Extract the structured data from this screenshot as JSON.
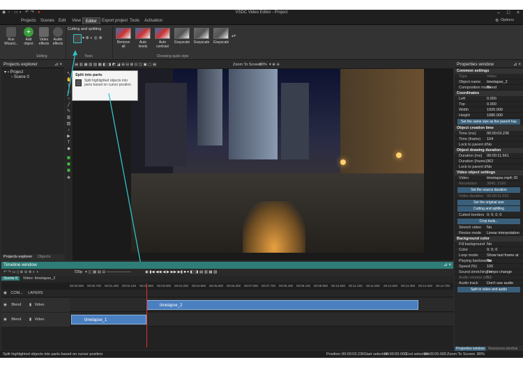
{
  "window": {
    "title": "VSDC Video Editor - Project"
  },
  "menu": [
    {
      "label": "Projects"
    },
    {
      "label": "Scenes"
    },
    {
      "label": "Edit"
    },
    {
      "label": "View"
    },
    {
      "label": "Editor"
    },
    {
      "label": "Export project"
    },
    {
      "label": "Tools"
    },
    {
      "label": "Activation"
    }
  ],
  "options_label": "Options",
  "ribbon": {
    "run_wizard": "Run Wizard...",
    "add_object": "Add object",
    "video_effects": "Video effects",
    "audio_effects": "Audio effects",
    "editing_group": "Editing",
    "cutting_label": "Cutting and splitting",
    "tools_group": "Tools",
    "quick_style_group": "Choosing quick style",
    "quick_styles": [
      "Remove all",
      "Auto levels",
      "Auto contrast",
      "Grayscale",
      "Grayscale",
      "Grayscale"
    ]
  },
  "tooltip": {
    "title": "Split into parts",
    "body": "Split highlighted objects into parts based on cursor position"
  },
  "projects_explorer": {
    "title": "Projects explorer",
    "project": "Project",
    "scene": "Scene 0",
    "tab1": "Projects explorer",
    "tab2": "Objects explorer"
  },
  "preview_toolbar": {
    "zoom": "Zoom To Screen",
    "percent": "80%"
  },
  "properties": {
    "title": "Properties window",
    "common": "Common settings",
    "type_lbl": "Type",
    "type_val": "Video",
    "name_lbl": "Object name",
    "name_val": "timelapse_2",
    "comp_lbl": "Composition mode",
    "comp_val": "Blend",
    "coords": "Coordinates",
    "left_lbl": "Left",
    "left_val": "0.000",
    "top_lbl": "Top",
    "top_val": "0.000",
    "width_lbl": "Width",
    "width_val": "1920.000",
    "height_lbl": "Height",
    "height_val": "1080.000",
    "same_size_btn": "Set the same size as the parent has",
    "creation": "Object creation time",
    "time_ms_lbl": "Time (ms)",
    "time_ms_val": "00:00:03.236",
    "time_frame_lbl": "Time (frame)",
    "time_frame_val": "104",
    "lock_lbl": "Lock to parent d",
    "lock_val": "No",
    "drawing": "Object drawing duration",
    "dur_ms_lbl": "Duration (ms)",
    "dur_ms_val": "00:00:11.561",
    "dur_frame_lbl": "Duration (frame)",
    "dur_frame_val": "362",
    "lock2_lbl": "Lock to parent d",
    "lock2_val": "No",
    "video_settings": "Video object settings",
    "video_lbl": "Video",
    "video_val": "timelapse.mp4; ID",
    "resolution_lbl": "Resolution",
    "resolution_val": "3840; 2160",
    "source_btn": "Set the source duration",
    "video_dur_lbl": "Video duration",
    "video_dur_val": "00:00:11.561",
    "orig_size_btn": "Set the original size",
    "cutting_btn": "Cutting and splitting",
    "cutted_lbl": "Cutted borders",
    "cutted_val": "0; 0; 0; 0",
    "crop_btn": "Crop tools...",
    "stretch_lbl": "Stretch video",
    "stretch_val": "No",
    "resize_lbl": "Resize mode",
    "resize_val": "Linear interpolation",
    "bg_color": "Background color",
    "fill_lbl": "Fill background",
    "fill_val": "No",
    "color_lbl": "Color",
    "color_val": "0; 0; 0",
    "loop_lbl": "Loop mode",
    "loop_val": "Show last frame at the",
    "playback_lbl": "Playing backwards",
    "playback_val": "No",
    "speed_lbl": "Speed (%)",
    "speed_val": "100",
    "sound_lbl": "Sound stretching m",
    "sound_val": "Tempo change",
    "audio_vol_lbl": "Audio volume (dB)",
    "audio_vol_val": "0.0",
    "audio_track_lbl": "Audio track",
    "audio_track_val": "Don't use audio",
    "split_btn": "Split to video and audio",
    "tab1": "Properties window",
    "tab2": "Resources window"
  },
  "timeline": {
    "title": "Timeline window",
    "tab_scene": "Scene 0",
    "tab_video": "Video: timelapse_2",
    "resolution": "720p",
    "com_label": "COM...",
    "layers": "LAYERS",
    "ticks": [
      "00:00.000",
      "00:00.700",
      "00:01.400",
      "00:02.100",
      "00:02.800",
      "00:03.500",
      "00:04.200",
      "00:04.900",
      "00:05.600",
      "00:06.300",
      "00:07.000",
      "00:07.700",
      "00:08.400",
      "00:09.100",
      "00:09.800",
      "00:10.500",
      "00:11.200",
      "00:11.900",
      "00:12.600",
      "00:13.300",
      "00:14.000",
      "00:14.700"
    ],
    "tracks": [
      {
        "blend": "Blend",
        "kind": "Video",
        "clip": "timelapse_2"
      },
      {
        "blend": "Blend",
        "kind": "Video",
        "clip": "timelapse_1"
      }
    ]
  },
  "status": {
    "message": "Split highlighted objects into parts based on cursor position",
    "position_lbl": "Position:",
    "position_val": "00:00:03.236",
    "start_lbl": "Start selection:",
    "start_val": "00:00:00.000",
    "end_lbl": "End selection:",
    "end_val": "00:00:00.000",
    "zoom_lbl": "Zoom To Screen",
    "zoom_val": "80%"
  },
  "colors": {
    "accent": "#2e7d78",
    "clip": "#4a7fc0",
    "callout": "#33c2c8"
  }
}
